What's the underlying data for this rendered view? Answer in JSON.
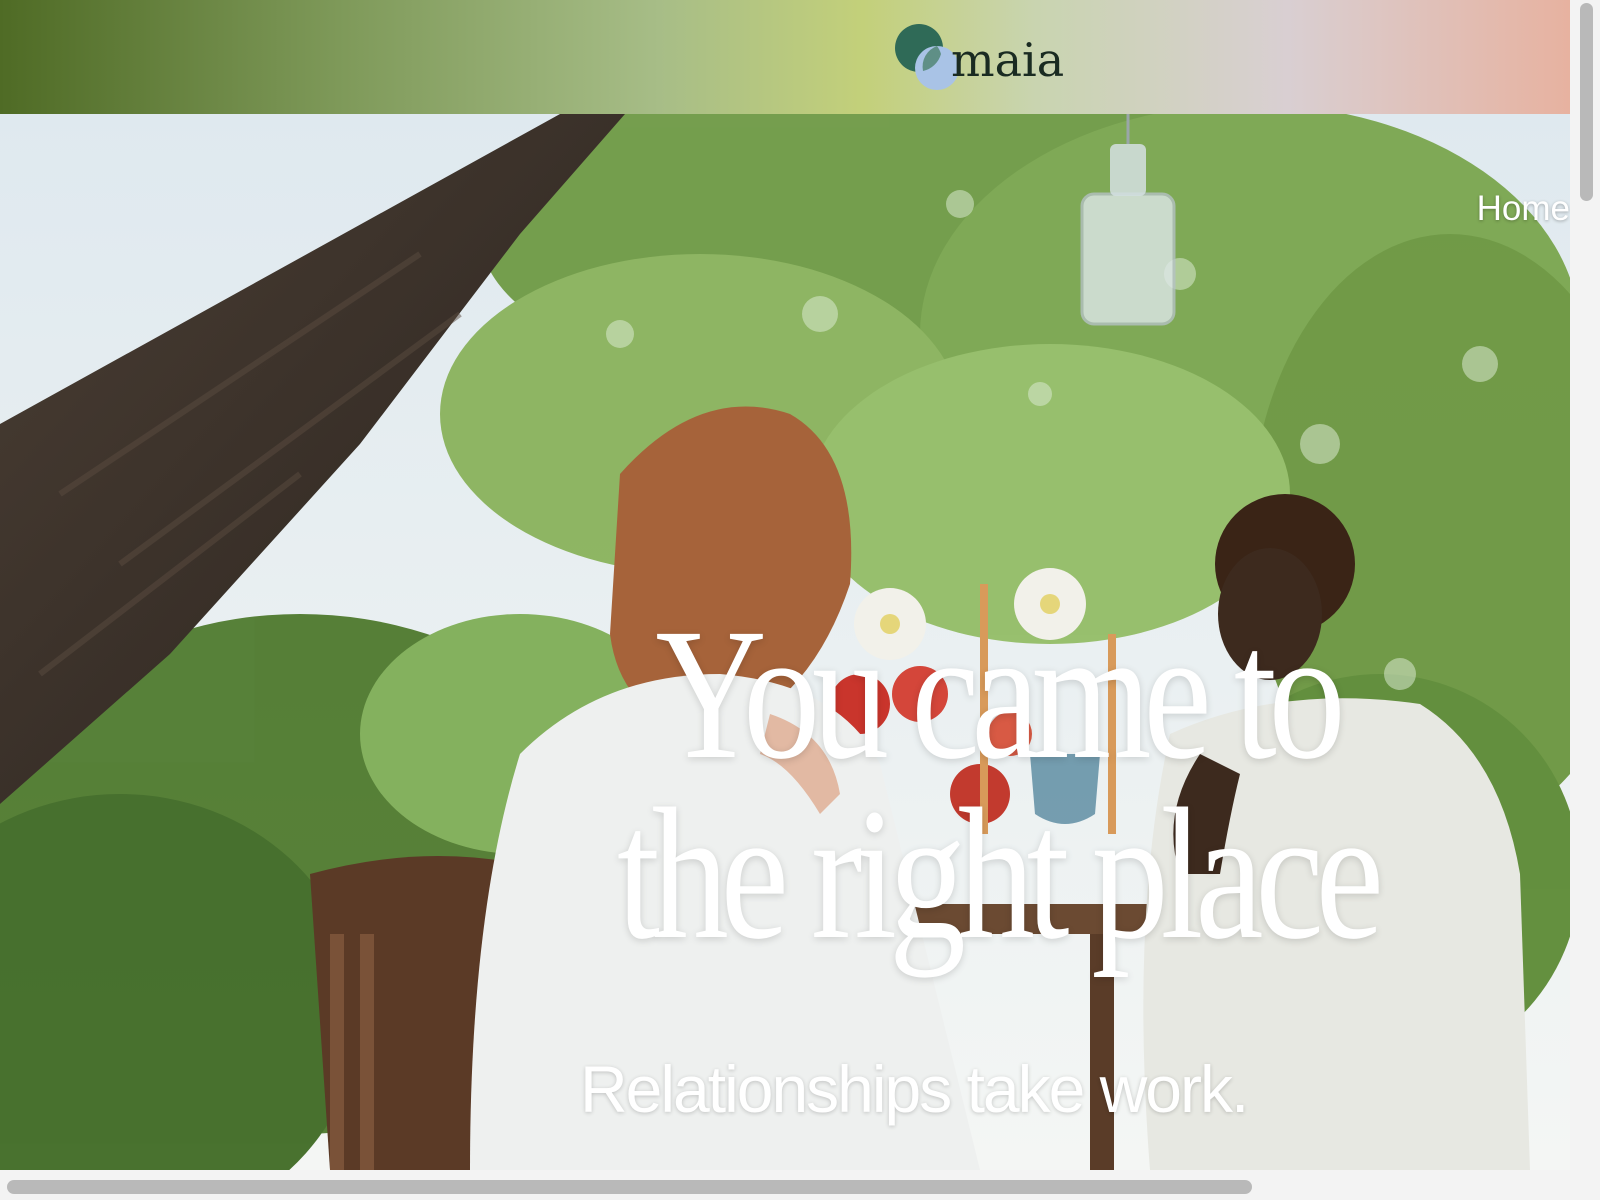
{
  "brand": {
    "name": "maia"
  },
  "nav": {
    "home_label": "Home"
  },
  "hero": {
    "headline_line1": "You came to",
    "headline_line2": "the right place",
    "subheadline": "Relationships take work."
  },
  "colors": {
    "logo_green": "#2f6a57",
    "logo_blue": "#a9c3e6",
    "text_white": "#ffffff"
  },
  "icons": {
    "logo_mark": "overlapping-circles"
  }
}
